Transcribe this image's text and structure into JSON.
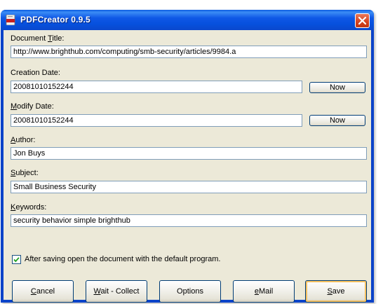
{
  "window": {
    "title": "PDFCreator 0.9.5"
  },
  "fields": [
    {
      "label": "Document Title:",
      "ul": "T",
      "value": "http://www.brighthub.com/computing/smb-security/articles/9984.a"
    },
    {
      "label": "Creation Date:",
      "ul": "",
      "value": "20081010152244",
      "button": "Now"
    },
    {
      "label": "Modify Date:",
      "ul": "M",
      "value": "20081010152244",
      "button": "Now"
    },
    {
      "label": "Author:",
      "ul": "A",
      "value": "Jon Buys"
    },
    {
      "label": "Subject:",
      "ul": "S",
      "value": "Small Business Security"
    },
    {
      "label": "Keywords:",
      "ul": "K",
      "value": "security behavior simple brighthub"
    }
  ],
  "checkbox": {
    "label": "After saving open the document with the default program.",
    "checked": true
  },
  "buttons": {
    "cancel": "Cancel",
    "wait_collect": "Wait - Collect",
    "options": "Options",
    "email": "eMail",
    "save": "Save"
  }
}
